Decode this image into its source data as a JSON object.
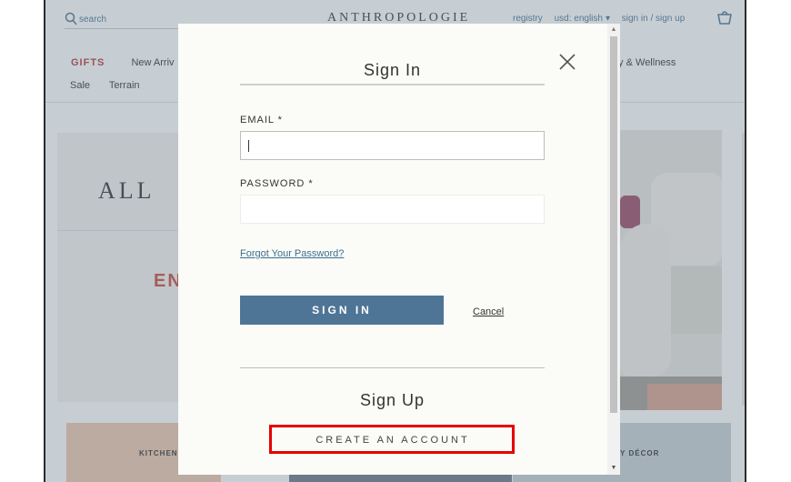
{
  "header": {
    "search_label": "search",
    "logo": "ANTHROPOLOGIE",
    "registry": "registry",
    "currency": "usd: english",
    "account": "sign in / sign up"
  },
  "nav": {
    "gifts": "GIFTS",
    "new_arrivals": "New Arriv",
    "beauty": "ty & Wellness",
    "sale": "Sale",
    "terrain": "Terrain"
  },
  "hero": {
    "headline": "ALL",
    "subhead": "EN"
  },
  "tiles": {
    "kitchen": "KITCHEN ·",
    "decor": "AY DÉCOR"
  },
  "modal": {
    "title": "Sign In",
    "email_label": "EMAIL *",
    "email_value": "",
    "password_label": "PASSWORD *",
    "password_value": "",
    "forgot_link": "Forgot Your Password?",
    "sign_in_button": "SIGN IN",
    "cancel_link": "Cancel",
    "signup_title": "Sign Up",
    "create_account_button": "CREATE AN ACCOUNT"
  },
  "icons": {
    "search": "search-icon",
    "basket": "basket-icon",
    "close": "close-icon",
    "currency_dropdown": "triangle-down-icon"
  },
  "colors": {
    "accent_blue": "#4f7596",
    "link_blue": "#3d6f8e",
    "gifts_red": "#b23a3a",
    "highlight_red": "#e60000",
    "modal_bg": "#fbfbf7"
  }
}
